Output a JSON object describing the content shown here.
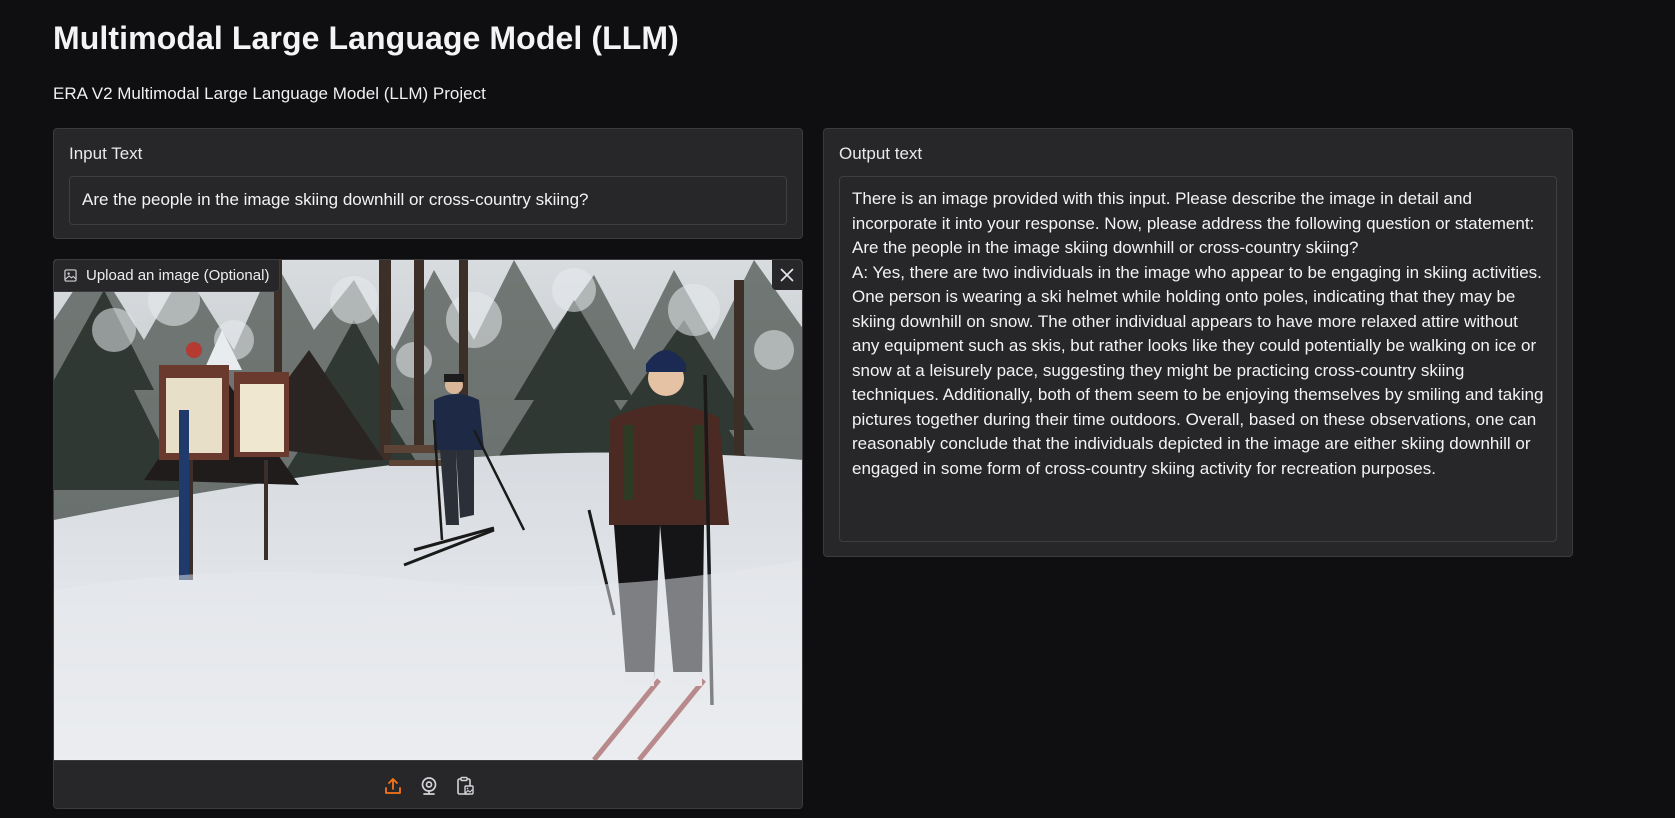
{
  "header": {
    "title": "Multimodal Large Language Model (LLM)",
    "subtitle": "ERA V2 Multimodal Large Language Model (LLM) Project"
  },
  "input": {
    "label": "Input Text",
    "value": "Are the people in the image skiing downhill or cross-country skiing?"
  },
  "image_upload": {
    "label": "Upload an image (Optional)",
    "image_description": "",
    "toolbar_icons": [
      "upload-icon",
      "webcam-icon",
      "clipboard-icon"
    ]
  },
  "output": {
    "label": "Output text",
    "value": "There is an image provided with this input. Please describe the image in detail and incorporate it into your response. Now, please address the following question or statement: Are the people in the image skiing downhill or cross-country skiing?\nA: Yes, there are two individuals in the image who appear to be engaging in skiing activities. One person is wearing a ski helmet while holding onto poles, indicating that they may be skiing downhill on snow. The other individual appears to have more relaxed attire without any equipment such as skis, but rather looks like they could potentially be walking on ice or snow at a leisurely pace, suggesting they might be practicing cross-country skiing techniques. Additionally, both of them seem to be enjoying themselves by smiling and taking pictures together during their time outdoors. Overall, based on these observations, one can reasonably conclude that the individuals depicted in the image are either skiing downhill or engaged in some form of cross-country skiing activity for recreation purposes."
  },
  "colors": {
    "background": "#0f0f11",
    "panel": "#27272a",
    "accent": "#f97316"
  }
}
